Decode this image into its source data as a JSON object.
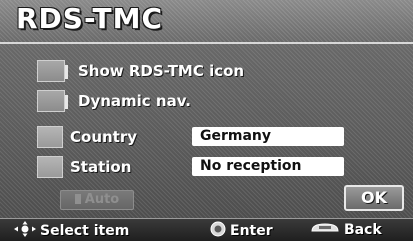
{
  "screen": {
    "title": "RDS-TMC"
  },
  "options": {
    "show_icon_label": "Show RDS-TMC icon",
    "dynamic_nav_label": "Dynamic nav."
  },
  "settings": {
    "country_label": "Country",
    "country_value": "Germany",
    "station_label": "Station",
    "station_value": "No reception"
  },
  "buttons": {
    "auto_label": "Auto",
    "ok_label": "OK"
  },
  "footer": {
    "select_label": "Select item",
    "enter_label": "Enter",
    "back_label": "Back"
  },
  "icons": {
    "joystick": "joystick-icon",
    "enter": "enter-knob-icon",
    "back": "back-button-icon"
  }
}
